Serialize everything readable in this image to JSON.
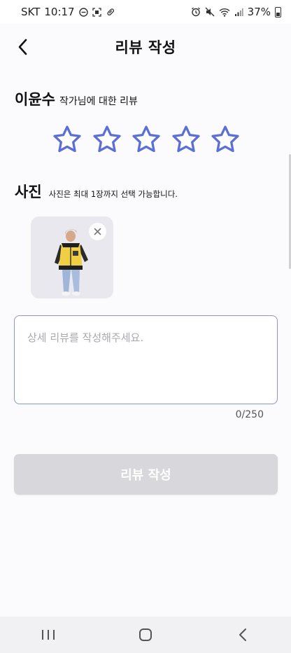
{
  "status_bar": {
    "carrier": "SKT",
    "time": "10:17",
    "battery_percent": "37%",
    "left_icons": [
      "minus-circle-icon",
      "screenshot-icon",
      "pill-icon"
    ],
    "right_icons": [
      "alarm-icon",
      "mute-icon",
      "wifi-icon",
      "signal-icon",
      "battery-icon"
    ]
  },
  "header": {
    "title": "리뷰 작성",
    "back_icon": "chevron-left-icon"
  },
  "author": {
    "name": "이윤수",
    "suffix": "작가님에 대한 리뷰"
  },
  "rating": {
    "max": 5,
    "value": 0,
    "star_color": "#5b6fd6"
  },
  "photos": {
    "title": "사진",
    "hint": "사진은 최대 1장까지 선택 가능합니다.",
    "items": [
      {
        "alt": "노란 재킷을 입은 남성 사진"
      }
    ],
    "remove_icon": "close-icon"
  },
  "review": {
    "placeholder": "상세 리뷰를 작성해주세요.",
    "value": "",
    "count": "0/250",
    "border_color": "#8a96c8"
  },
  "submit": {
    "label": "리뷰 작성",
    "enabled": false,
    "bg_color": "#d7d7dc"
  },
  "nav_bar": {
    "icons": [
      "recent-apps-icon",
      "home-icon",
      "back-icon"
    ]
  }
}
